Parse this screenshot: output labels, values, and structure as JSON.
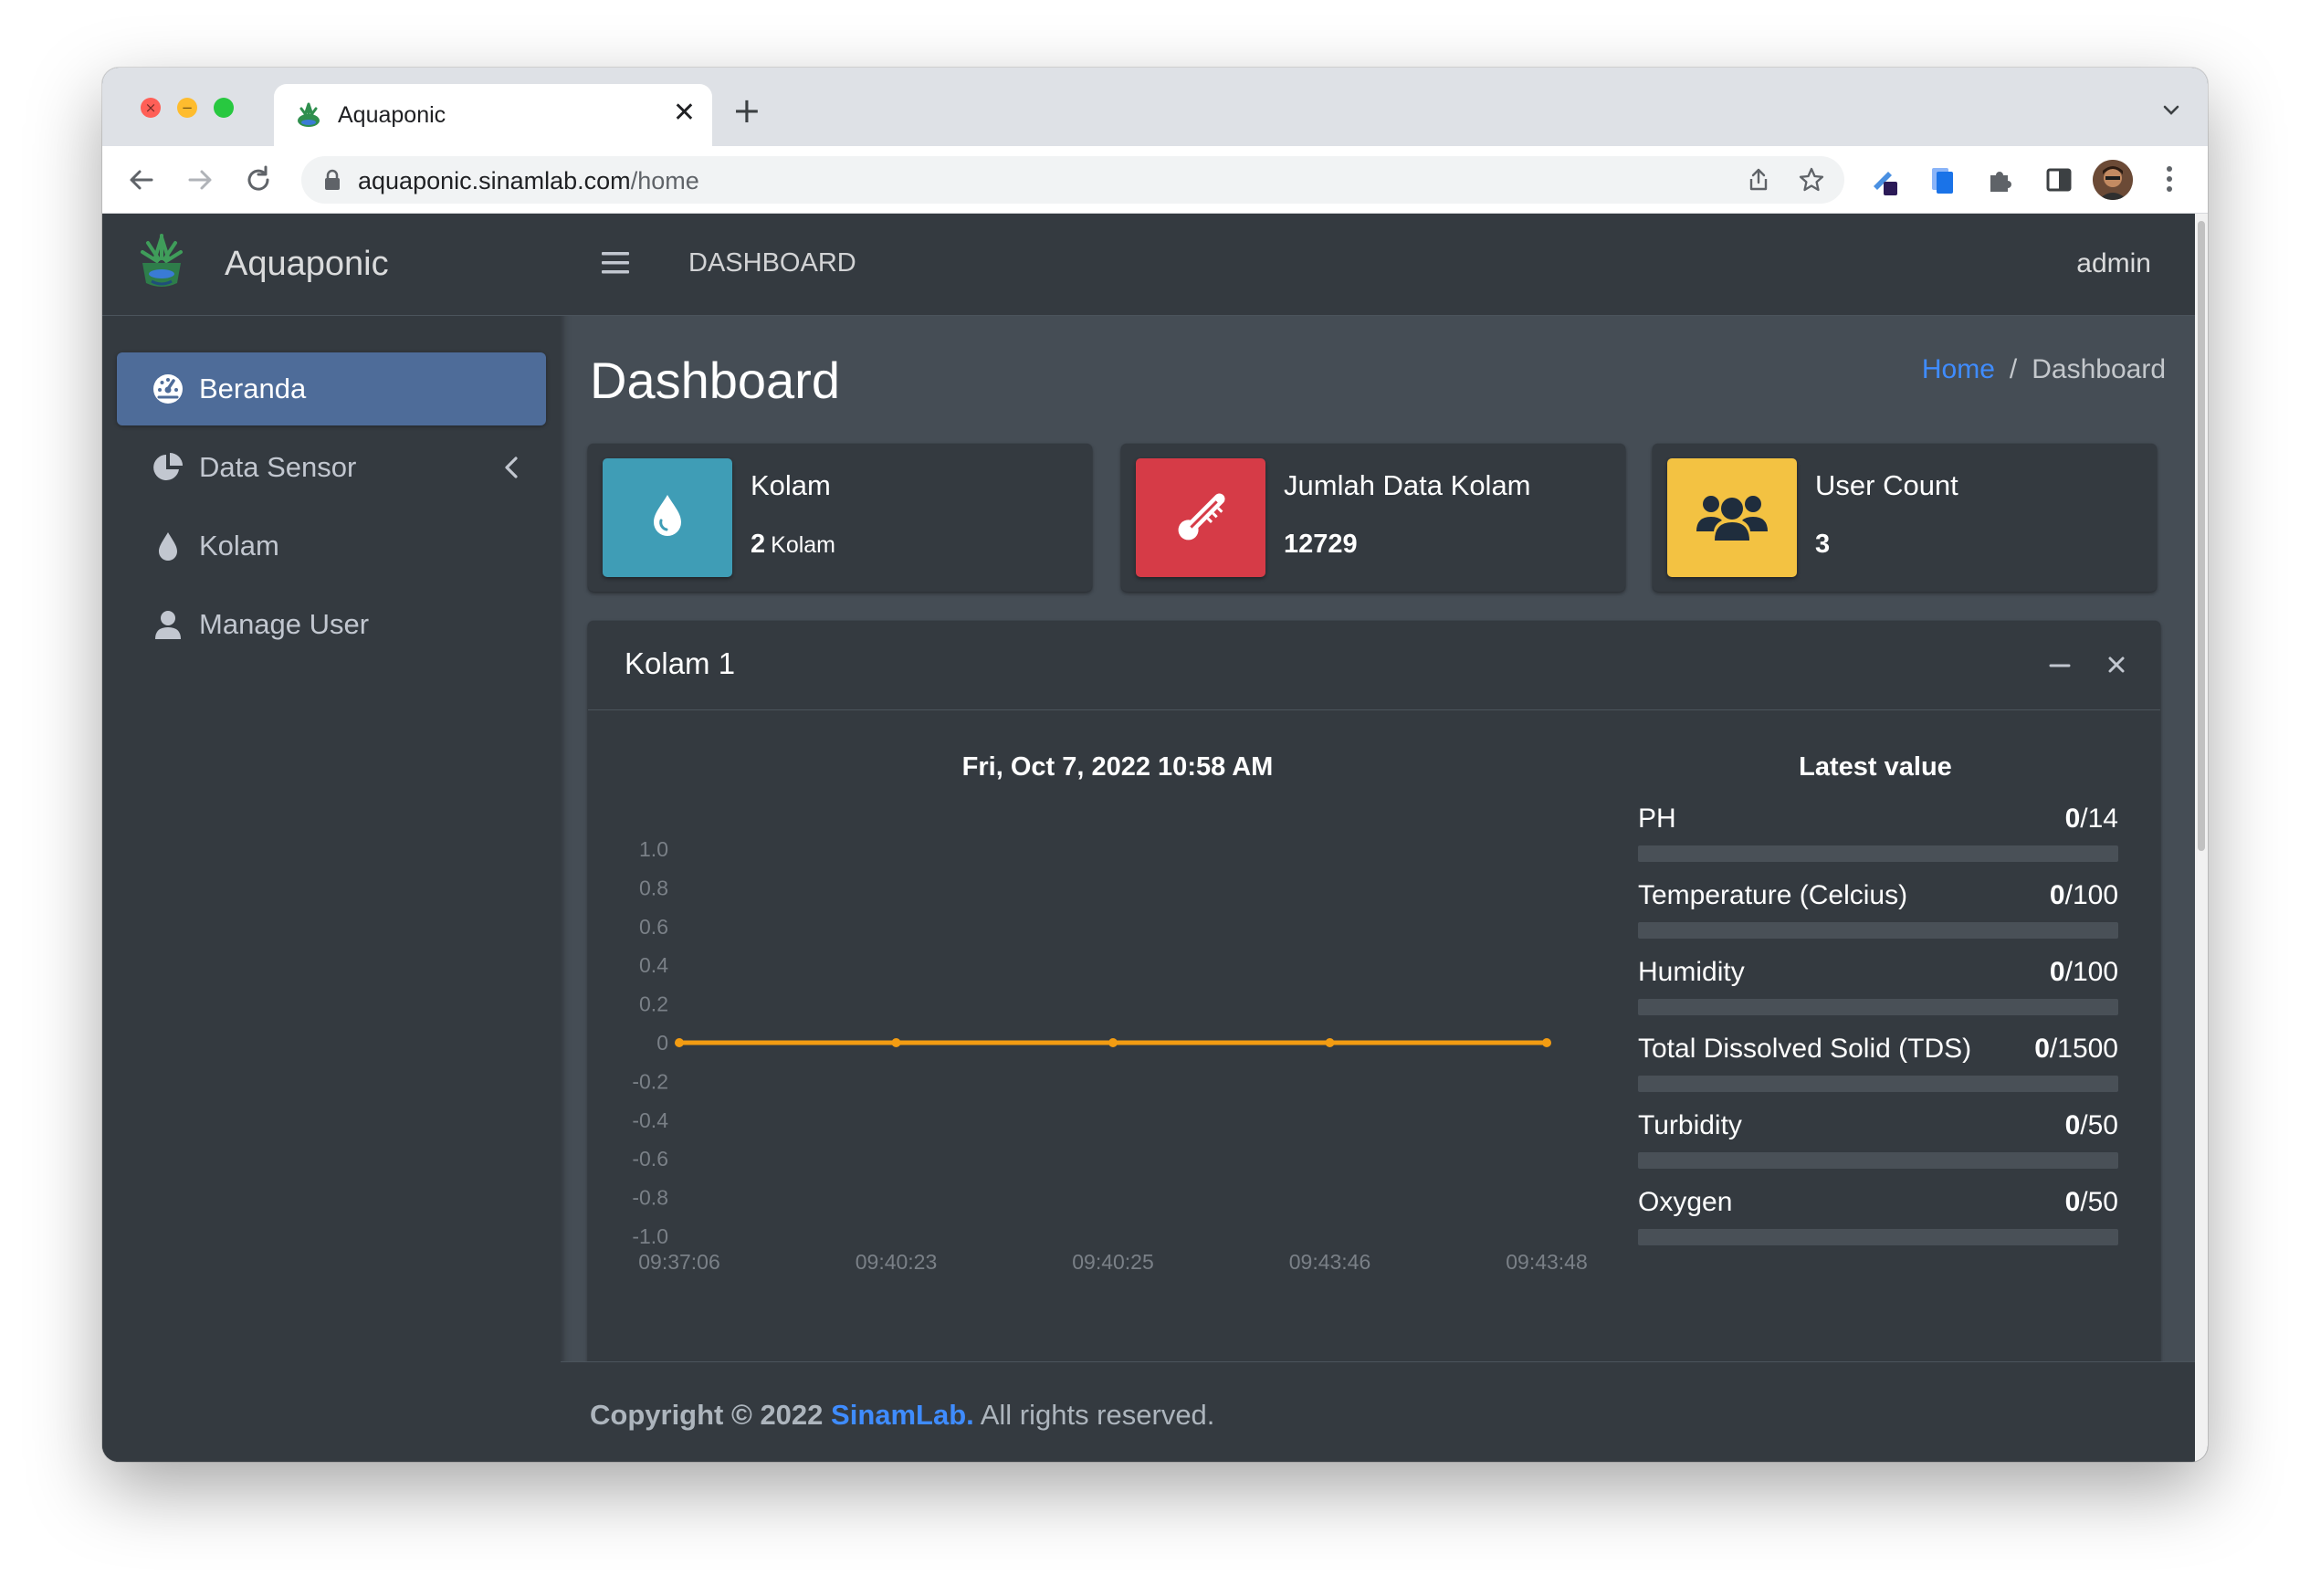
{
  "browser": {
    "tab_title": "Aquaponic",
    "url_host": "aquaponic.sinamlab.com",
    "url_path": "/home"
  },
  "sidebar": {
    "brand": "Aquaponic",
    "items": [
      {
        "label": "Beranda",
        "icon": "dashboard-gauge-icon",
        "active": true
      },
      {
        "label": "Data Sensor",
        "icon": "chart-pie-icon",
        "active": false,
        "has_submenu": true
      },
      {
        "label": "Kolam",
        "icon": "water-drop-icon",
        "active": false
      },
      {
        "label": "Manage User",
        "icon": "user-icon",
        "active": false
      }
    ]
  },
  "topnav": {
    "title": "DASHBOARD",
    "user": "admin"
  },
  "content": {
    "heading": "Dashboard",
    "breadcrumb": {
      "home": "Home",
      "separator": "/",
      "current": "Dashboard"
    }
  },
  "info_boxes": [
    {
      "label": "Kolam",
      "value": "2",
      "unit": "Kolam",
      "icon": "water-drop-icon",
      "color": "#3f9db6"
    },
    {
      "label": "Jumlah Data Kolam",
      "value": "12729",
      "icon": "thermometer-icon",
      "color": "#d63b47"
    },
    {
      "label": "User Count",
      "value": "3",
      "icon": "users-icon",
      "color": "#f3c242"
    }
  ],
  "card": {
    "title": "Kolam 1",
    "chart_title": "Fri, Oct 7, 2022 10:58 AM",
    "latest_title": "Latest value"
  },
  "chart_data": {
    "type": "line",
    "title": "Fri, Oct 7, 2022 10:58 AM",
    "xlabel": "",
    "ylabel": "",
    "x": [
      "09:37:06",
      "09:40:23",
      "09:40:25",
      "09:43:46",
      "09:43:48"
    ],
    "y_ticks": [
      "1.0",
      "0.8",
      "0.6",
      "0.4",
      "0.2",
      "0",
      "-0.2",
      "-0.4",
      "-0.6",
      "-0.8",
      "-1.0"
    ],
    "ylim": [
      -1,
      1
    ],
    "series": [
      {
        "values": [
          0,
          0,
          0,
          0,
          0
        ],
        "color": "#f39c12"
      }
    ],
    "grid": false
  },
  "metrics": [
    {
      "name": "PH",
      "value": "0",
      "max": "/14",
      "fraction": 0
    },
    {
      "name": "Temperature (Celcius)",
      "value": "0",
      "max": "/100",
      "fraction": 0
    },
    {
      "name": "Humidity",
      "value": "0",
      "max": "/100",
      "fraction": 0
    },
    {
      "name": "Total Dissolved Solid (TDS)",
      "value": "0",
      "max": "/1500",
      "fraction": 0
    },
    {
      "name": "Turbidity",
      "value": "0",
      "max": "/50",
      "fraction": 0
    },
    {
      "name": "Oxygen",
      "value": "0",
      "max": "/50",
      "fraction": 0
    }
  ],
  "footer": {
    "prefix": "Copyright © 2022",
    "link": "SinamLab.",
    "suffix": "All rights reserved."
  }
}
